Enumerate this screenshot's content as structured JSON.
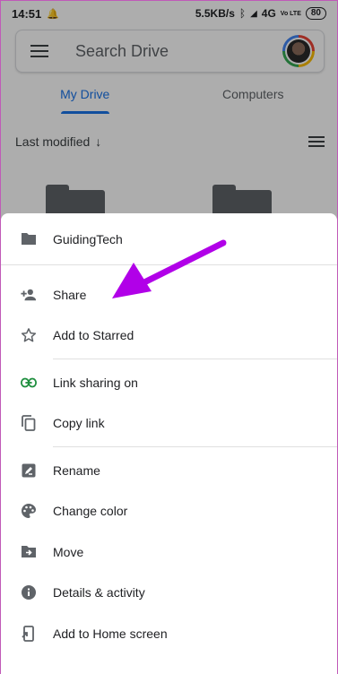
{
  "status_bar": {
    "time": "14:51",
    "network_speed": "5.5KB/s",
    "network_type": "4G",
    "volte": "Vo LTE",
    "battery": "80"
  },
  "search": {
    "placeholder": "Search Drive"
  },
  "tabs": [
    {
      "label": "My Drive",
      "active": true
    },
    {
      "label": "Computers",
      "active": false
    }
  ],
  "sort": {
    "label": "Last modified",
    "direction_icon": "arrow-down-icon"
  },
  "sheet": {
    "title": "GuidingTech",
    "title_icon": "folder-icon",
    "groups": [
      [
        {
          "label": "Share",
          "icon": "person-add-icon"
        },
        {
          "label": "Add to Starred",
          "icon": "star-outline-icon"
        }
      ],
      [
        {
          "label": "Link sharing on",
          "icon": "link-icon"
        },
        {
          "label": "Copy link",
          "icon": "copy-icon"
        }
      ],
      [
        {
          "label": "Rename",
          "icon": "rename-icon"
        },
        {
          "label": "Change color",
          "icon": "palette-icon"
        },
        {
          "label": "Move",
          "icon": "move-folder-icon"
        },
        {
          "label": "Details & activity",
          "icon": "info-icon"
        },
        {
          "label": "Add to Home screen",
          "icon": "add-to-home-icon"
        }
      ]
    ]
  },
  "colors": {
    "accent": "#1a73e8",
    "link_green": "#1e8e3e",
    "annotation_arrow": "#b100e8",
    "icon_gray": "#5f6368"
  }
}
